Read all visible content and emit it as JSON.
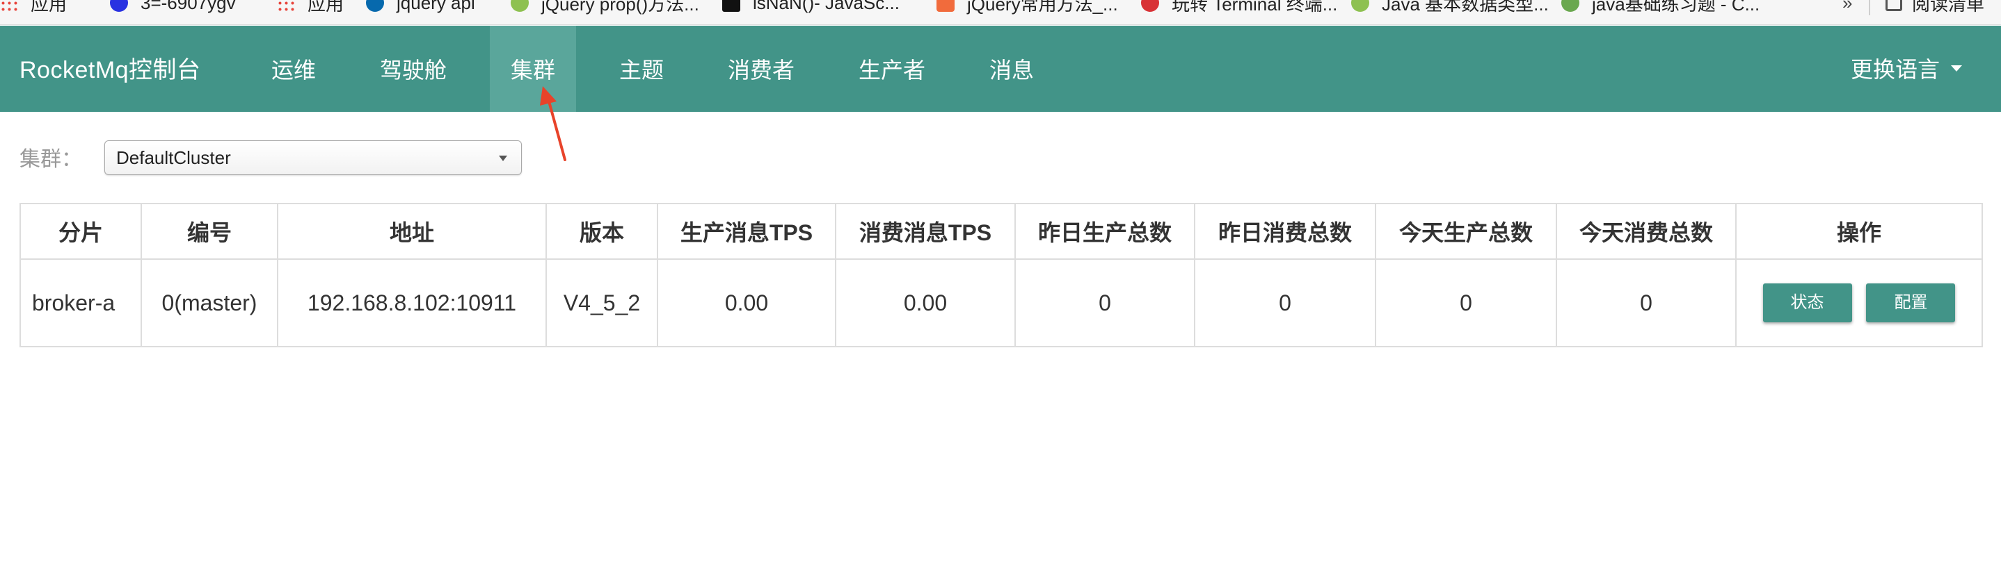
{
  "bookmarks": [
    {
      "label": "应用",
      "icon": "apps-grid-icon"
    },
    {
      "label": "3=-6907ygv",
      "icon": "baidu-icon"
    },
    {
      "label": "应用",
      "icon": "apps-grid-icon"
    },
    {
      "label": "jquery api",
      "icon": "jquery-icon"
    },
    {
      "label": "jQuery prop()方法...",
      "icon": "green-site-icon"
    },
    {
      "label": "isNaN()- JavaSc...",
      "icon": "mdn-icon"
    },
    {
      "label": "jQuery常用方法_...",
      "icon": "orange-site-icon"
    },
    {
      "label": "玩转 Terminal 终端...",
      "icon": "red-site-icon"
    },
    {
      "label": "Java 基本数据类型...",
      "icon": "green-site-icon"
    },
    {
      "label": "java基础练习题 - C...",
      "icon": "java-site-icon"
    }
  ],
  "bookmarks_more": "»",
  "reading_list": "阅读清单",
  "navbar": {
    "brand": "RocketMq控制台",
    "items": [
      {
        "label": "运维",
        "active": false
      },
      {
        "label": "驾驶舱",
        "active": false
      },
      {
        "label": "集群",
        "active": true
      },
      {
        "label": "主题",
        "active": false
      },
      {
        "label": "消费者",
        "active": false
      },
      {
        "label": "生产者",
        "active": false
      },
      {
        "label": "消息",
        "active": false
      }
    ],
    "language": "更换语言"
  },
  "filter": {
    "label": "集群：",
    "selected": "DefaultCluster"
  },
  "table": {
    "headers": [
      "分片",
      "编号",
      "地址",
      "版本",
      "生产消息TPS",
      "消费消息TPS",
      "昨日生产总数",
      "昨日消费总数",
      "今天生产总数",
      "今天消费总数",
      "操作"
    ],
    "rows": [
      [
        "broker-a",
        "0(master)",
        "192.168.8.102:10911",
        "V4_5_2",
        "0.00",
        "0.00",
        "0",
        "0",
        "0",
        "0"
      ]
    ],
    "actions": [
      "状态",
      "配置"
    ]
  },
  "colors": {
    "navbar": "#429488",
    "navbar_active": "#5aa69b",
    "annotation_arrow": "#e8432a"
  }
}
